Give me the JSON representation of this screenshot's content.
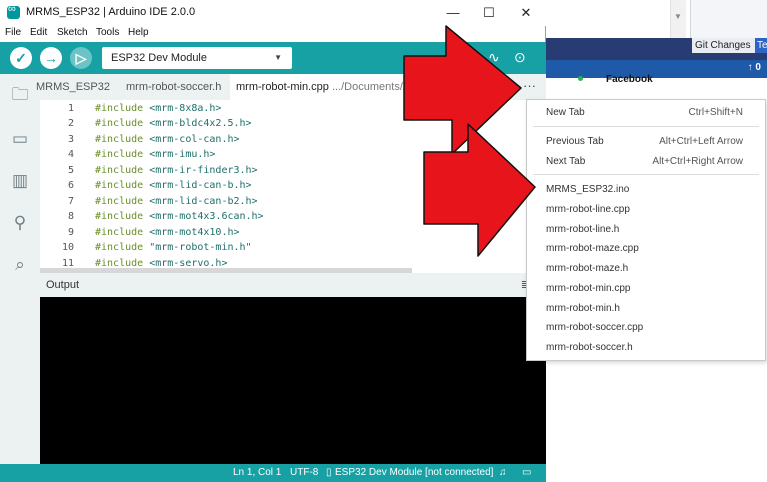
{
  "window": {
    "title": "MRMS_ESP32 | Arduino IDE 2.0.0",
    "minimize_glyph": "—",
    "maximize_glyph": "☐",
    "close_glyph": "✕"
  },
  "menubar": [
    "File",
    "Edit",
    "Sketch",
    "Tools",
    "Help"
  ],
  "toolbar": {
    "verify_glyph": "✓",
    "upload_glyph": "→",
    "debug_glyph": "▷",
    "board": "ESP32 Dev Module",
    "plotter_glyph": "∿",
    "monitor_glyph": "⊙"
  },
  "tabs": {
    "items": [
      {
        "label": "MRMS_ESP32"
      },
      {
        "label": "mrm-robot-soccer.h"
      }
    ],
    "active": {
      "label": "mrm-robot-min.cpp",
      "path": " .../Documents/A"
    },
    "more": "···"
  },
  "editor": {
    "lines": [
      {
        "n": "1",
        "kw": "#include",
        "rest": " <mrm-8x8a.h>"
      },
      {
        "n": "2",
        "kw": "#include",
        "rest": " <mrm-bldc4x2.5.h>"
      },
      {
        "n": "3",
        "kw": "#include",
        "rest": " <mrm-col-can.h>"
      },
      {
        "n": "4",
        "kw": "#include",
        "rest": " <mrm-imu.h>"
      },
      {
        "n": "5",
        "kw": "#include",
        "rest": " <mrm-ir-finder3.h>"
      },
      {
        "n": "6",
        "kw": "#include",
        "rest": " <mrm-lid-can-b.h>"
      },
      {
        "n": "7",
        "kw": "#include",
        "rest": " <mrm-lid-can-b2.h>"
      },
      {
        "n": "8",
        "kw": "#include",
        "rest": " <mrm-mot4x3.6can.h>"
      },
      {
        "n": "9",
        "kw": "#include",
        "rest": " <mrm-mot4x10.h>"
      },
      {
        "n": "10",
        "kw": "#include",
        "rest": " \"mrm-robot-min.h\""
      },
      {
        "n": "11",
        "kw": "#include",
        "rest": " <mrm-servo.h>"
      }
    ]
  },
  "output": {
    "label": "Output"
  },
  "statusbar": {
    "position": "Ln 1, Col 1",
    "encoding": "UTF-8",
    "board": "ESP32 Dev Module [not connected]"
  },
  "context_menu": {
    "new_tab": {
      "label": "New Tab",
      "shortcut": "Ctrl+Shift+N"
    },
    "previous_tab": {
      "label": "Previous Tab",
      "shortcut": "Alt+Ctrl+Left Arrow"
    },
    "next_tab": {
      "label": "Next Tab",
      "shortcut": "Alt+Ctrl+Right Arrow"
    },
    "files": [
      "MRMS_ESP32.ino",
      "mrm-robot-line.cpp",
      "mrm-robot-line.h",
      "mrm-robot-maze.cpp",
      "mrm-robot-maze.h",
      "mrm-robot-min.cpp",
      "mrm-robot-min.h",
      "mrm-robot-soccer.cpp",
      "mrm-robot-soccer.h"
    ]
  },
  "background_window": {
    "git_changes_tab": "Git Changes",
    "te_tab": "Te",
    "up_count": "↑ 0",
    "facebook": "Facebook"
  },
  "colors": {
    "teal": "#17a1a5",
    "arrow_red": "#e8141b",
    "vs_navy": "#263c72"
  }
}
